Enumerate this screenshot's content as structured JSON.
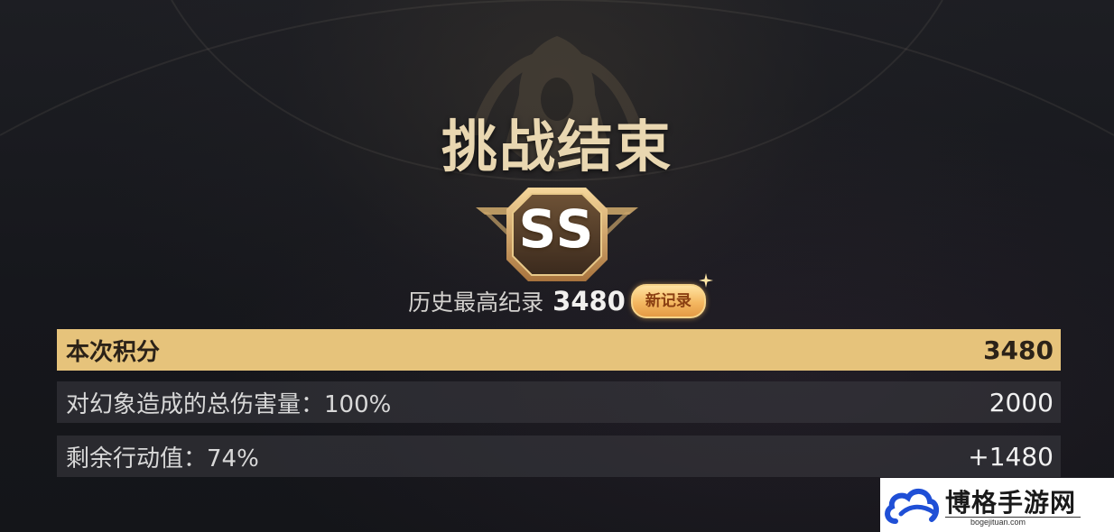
{
  "header": {
    "title": "挑战结束"
  },
  "rank": {
    "grade": "SS"
  },
  "record": {
    "label": "历史最高纪录",
    "value": "3480",
    "new_badge": "新记录"
  },
  "scores": {
    "total": {
      "label": "本次积分",
      "value": "3480"
    },
    "rows": [
      {
        "label": "对幻象造成的总伤害量：100%",
        "value": "2000"
      },
      {
        "label": "剩余行动值：74%",
        "value": "+1480"
      }
    ]
  },
  "watermark": {
    "name": "博格手游网",
    "url": "bogejituan.com"
  },
  "colors": {
    "title_gold": "#e9d7b1",
    "highlight_row": "#e6c37b",
    "badge_orange": "#f4b861",
    "row_bg": "#3c3c42",
    "watermark_blue": "#1f4fd6"
  },
  "icons": {
    "rank": "ss-rank-badge-icon",
    "sparkle": "sparkle-icon",
    "logo": "cloud-logo-icon",
    "background": "hooded-figure-emblem-icon"
  }
}
